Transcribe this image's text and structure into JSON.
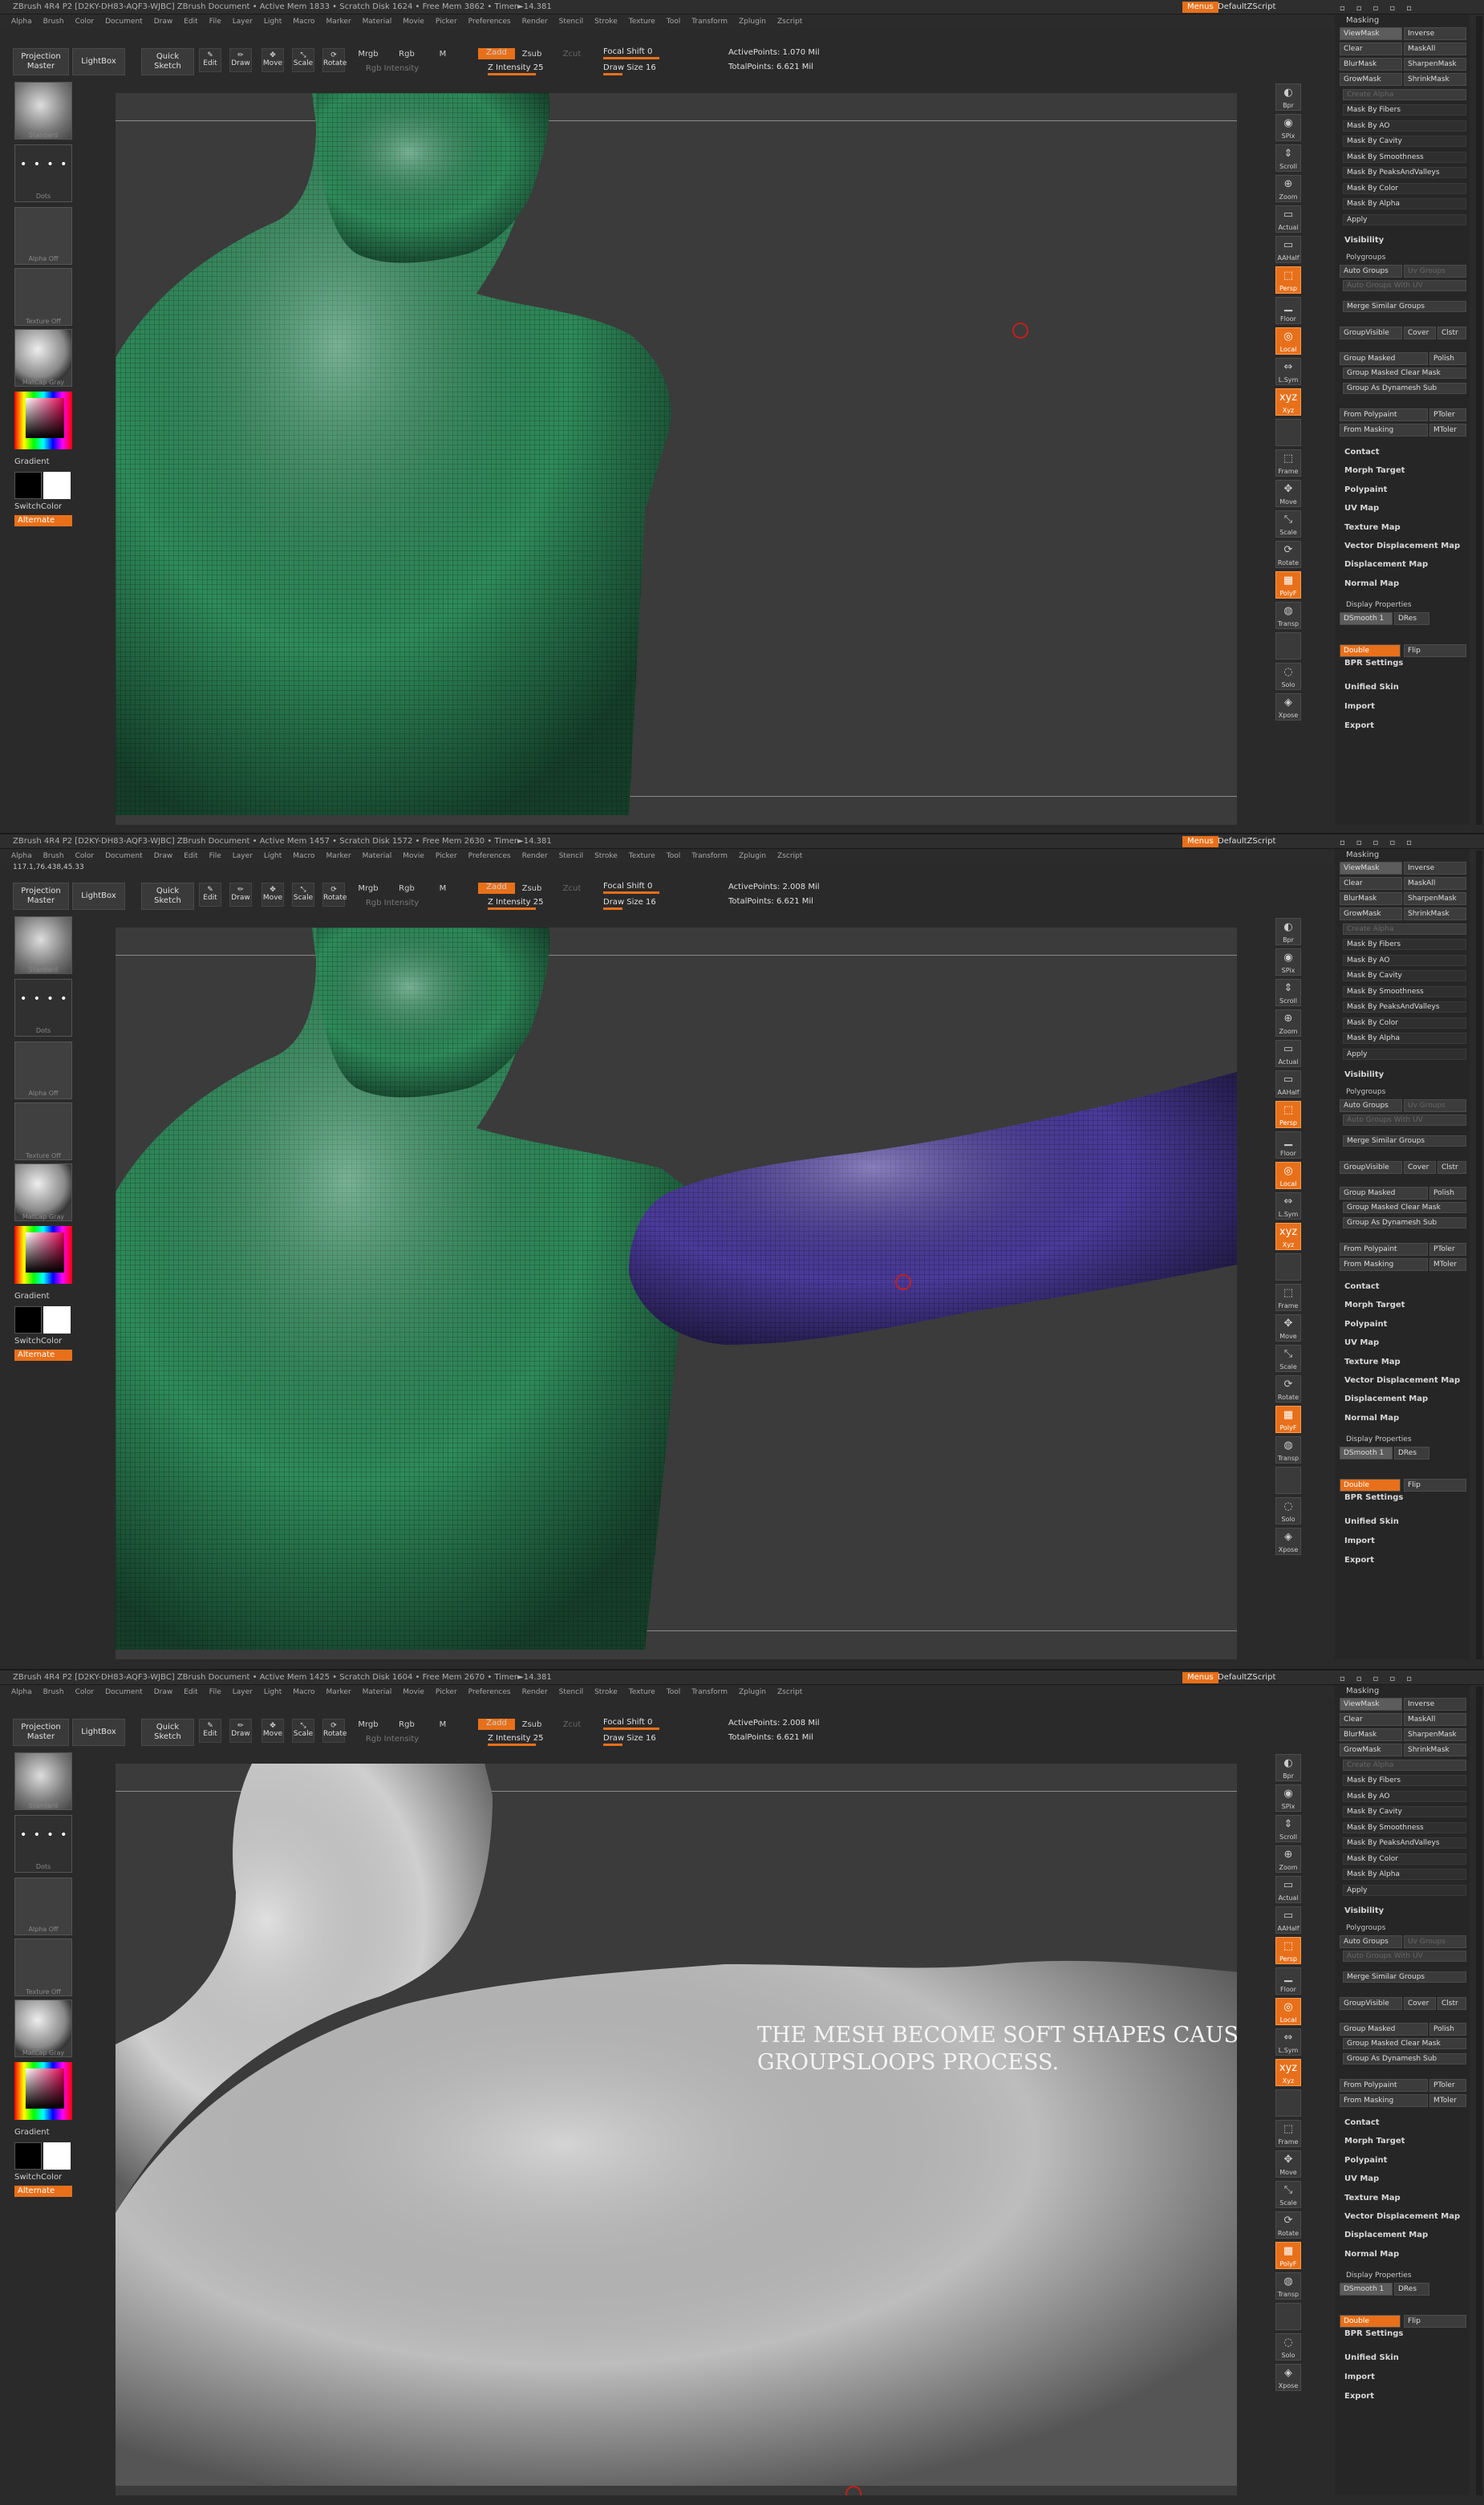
{
  "app": {
    "menus_button": "Menus",
    "script_label": "DefaultZScript",
    "window_buttons": [
      "□",
      "□",
      "□",
      "□",
      "□"
    ]
  },
  "menus": [
    "Alpha",
    "Brush",
    "Color",
    "Document",
    "Draw",
    "Edit",
    "File",
    "Layer",
    "Light",
    "Macro",
    "Marker",
    "Material",
    "Movie",
    "Picker",
    "Preferences",
    "Render",
    "Stencil",
    "Stroke",
    "Texture",
    "Tool",
    "Transform",
    "Zplugin",
    "Zscript"
  ],
  "toolbar": {
    "projection_master": "Projection Master",
    "lightbox": "LightBox",
    "quick_sketch": "Quick Sketch",
    "edit": "Edit",
    "draw": "Draw",
    "move": "Move",
    "scale": "Scale",
    "rotate": "Rotate",
    "mrgb": "Mrgb",
    "rgb": "Rgb",
    "m": "M",
    "rgb_intensity": "Rgb Intensity",
    "zadd": "Zadd",
    "zsub": "Zsub",
    "zcut": "Zcut",
    "z_intensity": "Z Intensity 25",
    "focal_shift": "Focal Shift 0",
    "draw_size": "Draw Size 16"
  },
  "leftshelf": {
    "brush_label": "Standard",
    "stroke_label": "Dots",
    "alpha_label": "Alpha Off",
    "texture_label": "Texture Off",
    "material_label": "MatCap Gray",
    "gradient": "Gradient",
    "switch_color": "SwitchColor",
    "alternate": "Alternate"
  },
  "rightshelf": [
    "Bpr",
    "SPix",
    "Scroll",
    "Zoom",
    "Actual",
    "AAHalf",
    "Persp",
    "Floor",
    "Local",
    "L.Sym",
    "Xyz",
    "",
    "Frame",
    "Move",
    "Scale",
    "Rotate",
    "PolyF",
    "Transp",
    "",
    "Solo",
    "Xpose"
  ],
  "toolpanel": {
    "masking": "Masking",
    "mask_grid": [
      [
        "ViewMask",
        "Inverse"
      ],
      [
        "Clear",
        "MaskAll"
      ],
      [
        "BlurMask",
        "SharpenMask"
      ],
      [
        "GrowMask",
        "ShrinkMask"
      ]
    ],
    "create_alpha": "Create Alpha",
    "mask_items": [
      "Mask By Fibers",
      "Mask By AO",
      "Mask By Cavity",
      "Mask By Smoothness",
      "Mask By PeaksAndValleys",
      "Mask By Color",
      "Mask By Alpha",
      "Apply"
    ],
    "visibility": "Visibility",
    "polygroups": "Polygroups",
    "auto_groups": "Auto Groups",
    "uv_groups": "Uv Groups",
    "auto_groups_with_uv": "Auto Groups With UV",
    "merge_similar": "Merge Similar Groups",
    "groupvisible": "GroupVisible",
    "coverage": "Cover",
    "clstr": "Clstr",
    "group_masked": "Group Masked",
    "polish": "Polish",
    "group_masked_clear": "Group Masked Clear Mask",
    "group_as_dynamesh": "Group As Dynamesh Sub",
    "from_polypaint": "From Polypaint",
    "ptolerance": "PToler",
    "from_masking": "From Masking",
    "mtolerance": "MToler",
    "sections": [
      "Contact",
      "Morph Target",
      "Polypaint",
      "UV Map",
      "Texture Map",
      "Vector Displacement Map",
      "Displacement Map",
      "Normal Map"
    ],
    "display_properties": "Display Properties",
    "dsmooth": "DSmooth 1",
    "dres": "DRes",
    "bpr_settings": "BPR Settings",
    "double": "Double",
    "flip": "Flip",
    "unified_skin": "Unified Skin",
    "import": "Import",
    "export": "Export"
  },
  "panels": [
    {
      "title": "ZBrush 4R4 P2  [D2KY-DH83-AQF3-WJBC]   ZBrush Document    • Active Mem 1833  • Scratch Disk 1624  • Free Mem 3862  • Timer►14.381",
      "coords": "",
      "active_points": "ActivePoints: 1.070 Mil",
      "total_points": "TotalPoints: 6.621 Mil",
      "annotation": ""
    },
    {
      "title": "ZBrush 4R4 P2  [D2KY-DH83-AQF3-WJBC]   ZBrush Document    • Active Mem 1457  • Scratch Disk 1572  • Free Mem 2630  • Timer►14.381",
      "coords": "117.1,76.438,45.33",
      "active_points": "ActivePoints: 2.008 Mil",
      "total_points": "TotalPoints: 6.621 Mil",
      "annotation": ""
    },
    {
      "title": "ZBrush 4R4 P2  [D2KY-DH83-AQF3-WJBC]   ZBrush Document    • Active Mem 1425  • Scratch Disk 1604  • Free Mem 2670  • Timer►14.381",
      "coords": "",
      "active_points": "ActivePoints: 2.008 Mil",
      "total_points": "TotalPoints: 6.621 Mil",
      "annotation": "THE MESH BECOME SOFT SHAPES CAUSE THE GROUPSLOOPS PROCESS."
    }
  ],
  "colors": {
    "accent": "#e8701a",
    "mesh_green": "#2e8a5a",
    "mesh_purple": "#4a3a9a",
    "mesh_gray": "#bdbdbd",
    "viewport_bg": "#3b3b3b"
  }
}
